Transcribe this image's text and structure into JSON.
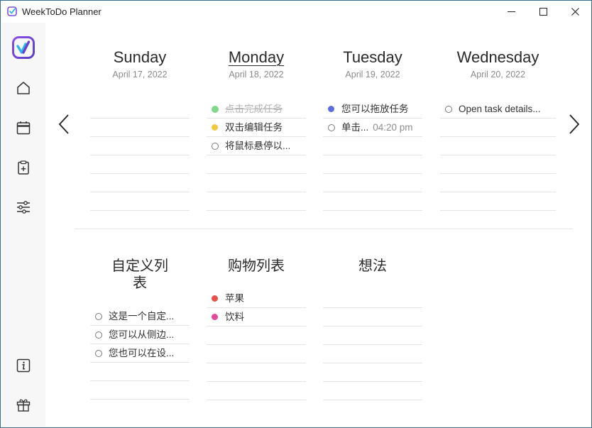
{
  "window": {
    "title": "WeekToDo Planner"
  },
  "sidebar": {
    "items": [
      {
        "name": "logo"
      },
      {
        "name": "home"
      },
      {
        "name": "calendar"
      },
      {
        "name": "custom-lists"
      },
      {
        "name": "settings"
      },
      {
        "name": "info"
      },
      {
        "name": "gift"
      }
    ]
  },
  "days": [
    {
      "name": "Sunday",
      "date": "April 17, 2022",
      "today": false,
      "tasks": []
    },
    {
      "name": "Monday",
      "date": "April 18, 2022",
      "today": true,
      "tasks": [
        {
          "text": "点击完成任务",
          "color": "#7fd88a",
          "status": "done"
        },
        {
          "text": "双击编辑任务",
          "color": "#f5c842",
          "status": "open"
        },
        {
          "text": "将鼠标悬停以...",
          "color": "",
          "status": "open"
        }
      ]
    },
    {
      "name": "Tuesday",
      "date": "April 19, 2022",
      "today": false,
      "tasks": [
        {
          "text": "您可以拖放任务",
          "color": "#5b6ee1",
          "status": "open"
        },
        {
          "text": "单击...",
          "time": "04:20 pm",
          "color": "",
          "status": "open"
        }
      ]
    },
    {
      "name": "Wednesday",
      "date": "April 20, 2022",
      "today": false,
      "tasks": [
        {
          "text": "Open task details...",
          "color": "",
          "status": "open"
        }
      ]
    }
  ],
  "lists": [
    {
      "title": "自定义列表",
      "tasks": [
        {
          "text": "这是一个自定...",
          "color": ""
        },
        {
          "text": "您可以从侧边...",
          "color": ""
        },
        {
          "text": "您也可以在设...",
          "color": ""
        }
      ]
    },
    {
      "title": "购物列表",
      "tasks": [
        {
          "text": "苹果",
          "color": "#e8524a"
        },
        {
          "text": "饮料",
          "color": "#e44c9a"
        }
      ]
    },
    {
      "title": "想法",
      "tasks": []
    }
  ],
  "colors": {
    "accent_purple": "#6a3fd1",
    "accent_blue": "#2bb5e8"
  }
}
